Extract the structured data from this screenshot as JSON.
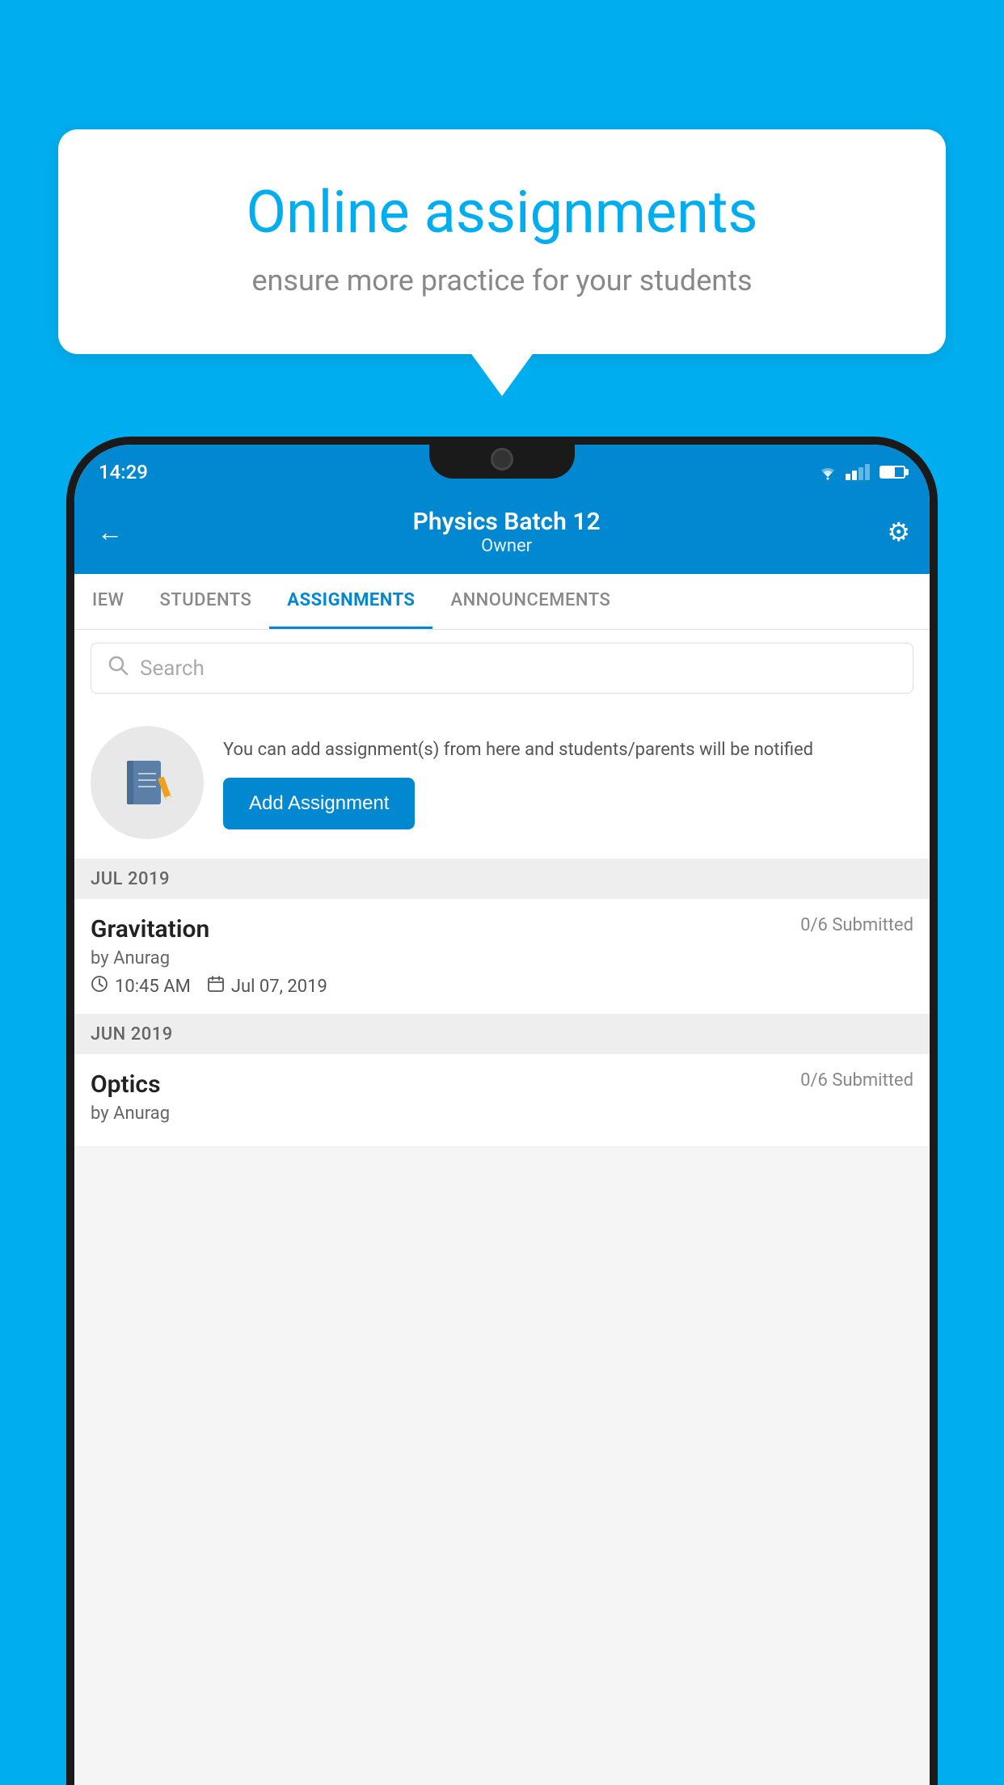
{
  "background_color": "#00AEEF",
  "speech_bubble": {
    "title": "Online assignments",
    "subtitle": "ensure more practice for your students"
  },
  "status_bar": {
    "time": "14:29"
  },
  "header": {
    "title": "Physics Batch 12",
    "subtitle": "Owner",
    "back_label": "←",
    "settings_label": "⚙"
  },
  "tabs": [
    {
      "label": "IEW",
      "active": false
    },
    {
      "label": "STUDENTS",
      "active": false
    },
    {
      "label": "ASSIGNMENTS",
      "active": true
    },
    {
      "label": "ANNOUNCEMENTS",
      "active": false
    }
  ],
  "search": {
    "placeholder": "Search"
  },
  "info_box": {
    "description": "You can add assignment(s) from here and students/parents will be notified",
    "button_label": "Add Assignment"
  },
  "sections": [
    {
      "label": "JUL 2019",
      "assignments": [
        {
          "title": "Gravitation",
          "submitted": "0/6 Submitted",
          "author": "by Anurag",
          "time": "10:45 AM",
          "date": "Jul 07, 2019"
        }
      ]
    },
    {
      "label": "JUN 2019",
      "assignments": [
        {
          "title": "Optics",
          "submitted": "0/6 Submitted",
          "author": "by Anurag",
          "time": "",
          "date": ""
        }
      ]
    }
  ]
}
